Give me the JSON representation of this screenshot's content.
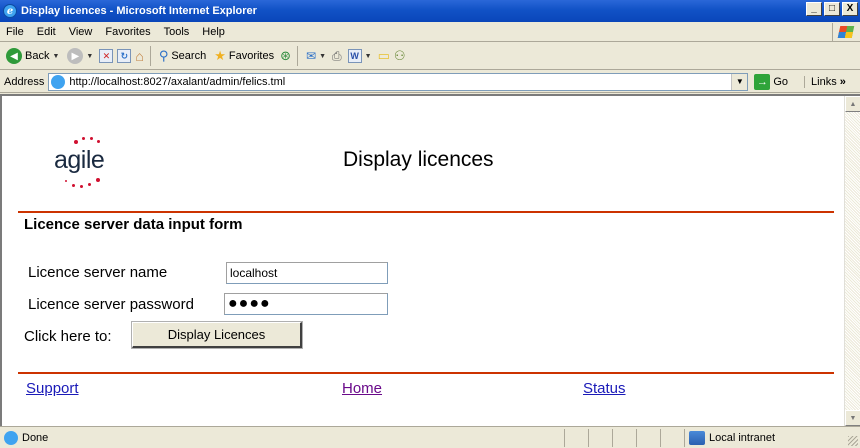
{
  "window": {
    "title": "Display licences - Microsoft Internet Explorer",
    "minimize": "_",
    "maximize": "□",
    "close": "X"
  },
  "menu": {
    "items": [
      "File",
      "Edit",
      "View",
      "Favorites",
      "Tools",
      "Help"
    ]
  },
  "toolbar": {
    "back_label": "Back",
    "search_label": "Search",
    "favorites_label": "Favorites"
  },
  "address": {
    "label": "Address",
    "url": "http://localhost:8027/axalant/admin/felics.tml",
    "go_label": "Go",
    "links_label": "Links"
  },
  "page": {
    "logo_text": "agile",
    "heading": "Display licences",
    "section_title": "Licence server data input form",
    "form": {
      "server_name_label": "Licence server name",
      "server_name_value": "localhost",
      "password_label": "Licence server password",
      "password_masked": "●●●●",
      "click_label": "Click here to:",
      "button_label": "Display Licences"
    },
    "footer_links": {
      "support": "Support",
      "home": "Home",
      "status": "Status"
    }
  },
  "status": {
    "text": "Done",
    "zone": "Local intranet"
  },
  "colors": {
    "accent_rule": "#cc3300",
    "link": "#1a1ab8",
    "visited_link": "#6a0a8a",
    "title_bar": "#0a46b9"
  }
}
